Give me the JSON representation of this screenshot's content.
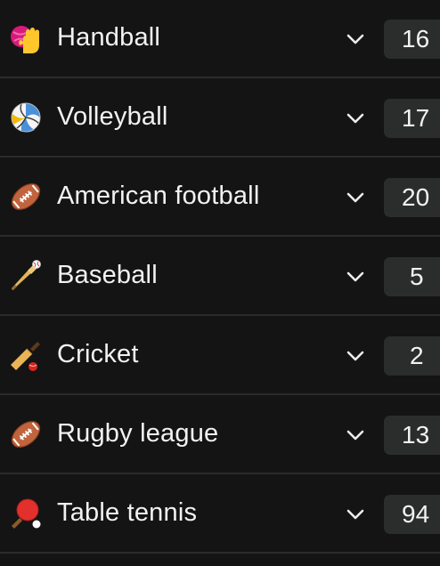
{
  "sports": [
    {
      "name": "Handball",
      "count": "16",
      "icon": "handball-icon"
    },
    {
      "name": "Volleyball",
      "count": "17",
      "icon": "volleyball-icon"
    },
    {
      "name": "American football",
      "count": "20",
      "icon": "american-football-icon"
    },
    {
      "name": "Baseball",
      "count": "5",
      "icon": "baseball-icon"
    },
    {
      "name": "Cricket",
      "count": "2",
      "icon": "cricket-icon"
    },
    {
      "name": "Rugby league",
      "count": "13",
      "icon": "rugby-ball-icon"
    },
    {
      "name": "Table tennis",
      "count": "94",
      "icon": "ping-pong-icon"
    }
  ],
  "colors": {
    "background": "#141414",
    "divider": "#2b2b2b",
    "badge": "#2a2d2c",
    "text": "#f2f2f2"
  }
}
